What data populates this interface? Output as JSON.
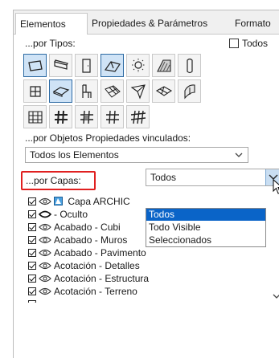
{
  "tabs": [
    {
      "label": "Elementos",
      "active": true
    },
    {
      "label": "Propiedades & Parámetros",
      "active": false
    },
    {
      "label": "Formato",
      "active": false
    }
  ],
  "by_types": {
    "label": "...por Tipos:",
    "all_checkbox_label": "Todos",
    "all_checked": false,
    "tiles": [
      {
        "icon": "wall-icon",
        "selected": true
      },
      {
        "icon": "beam-icon",
        "selected": false
      },
      {
        "icon": "door-icon",
        "selected": false
      },
      {
        "icon": "roof-icon",
        "selected": true
      },
      {
        "icon": "lamp-icon",
        "selected": false
      },
      {
        "icon": "shell-icon",
        "selected": false
      },
      {
        "icon": "column-icon",
        "selected": false
      },
      {
        "icon": "window-icon",
        "selected": false
      },
      {
        "icon": "slab-icon",
        "selected": true
      },
      {
        "icon": "object-icon",
        "selected": false
      },
      {
        "icon": "mesh-icon",
        "selected": false
      },
      {
        "icon": "morph-icon",
        "selected": false
      },
      {
        "icon": "stair-icon",
        "selected": false
      },
      {
        "icon": "curtain-wall-icon",
        "selected": false
      },
      {
        "icon": "curtain-wall-grid-icon",
        "selected": false
      },
      {
        "icon": "frame-icon",
        "selected": false
      },
      {
        "icon": "panel-icon",
        "selected": false
      },
      {
        "icon": "accessory-icon",
        "selected": false
      },
      {
        "icon": "junction-icon",
        "selected": false
      }
    ]
  },
  "by_linked_properties": {
    "label": "...por Objetos Propiedades vinculados:",
    "value": "Todos los Elementos"
  },
  "by_layers": {
    "label": "...por Capas:",
    "select_value": "Todos",
    "dropdown_options": [
      "Todos",
      "Todo Visible",
      "Seleccionados"
    ],
    "highlighted_option": "Todos",
    "rows": [
      "Capa ARCHIC",
      "- Oculto",
      "Acabado - Cubi",
      "Acabado - Muros",
      "Acabado - Pavimento",
      "Acotación - Detalles",
      "Acotación - Estructura",
      "Acotación - Terreno"
    ]
  },
  "colors": {
    "highlight_box": "#e02020",
    "selected_tile": "#cfe3f6",
    "dropdown_highlight": "#0a64c8"
  }
}
